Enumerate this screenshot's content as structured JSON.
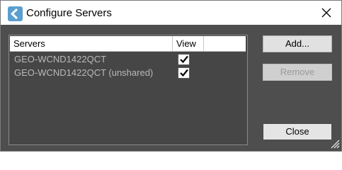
{
  "window": {
    "title": "Configure Servers",
    "icons": {
      "app": "app-back-arrow-icon",
      "close": "close-icon",
      "resize": "resize-grip-icon"
    }
  },
  "server_list": {
    "columns": [
      "Servers",
      "View"
    ],
    "rows": [
      {
        "name": "GEO-WCND1422QCT",
        "view_checked": true
      },
      {
        "name": "GEO-WCND1422QCT (unshared)",
        "view_checked": true
      }
    ]
  },
  "buttons": {
    "add": "Add...",
    "remove": "Remove",
    "close": "Close"
  },
  "colors": {
    "panel_bg": "#4e4e4e",
    "list_bg": "#464646",
    "row_text": "#b9b9b9",
    "button_bg": "#e1e1e1"
  }
}
